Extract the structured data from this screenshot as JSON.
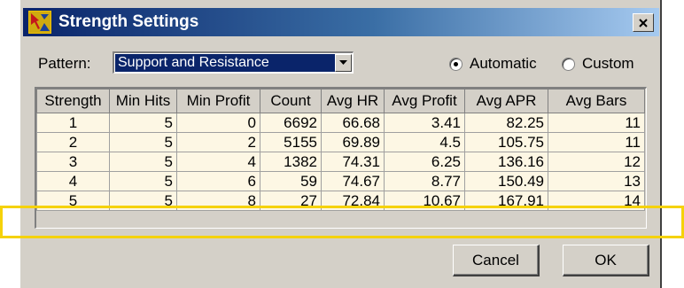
{
  "window": {
    "title": "Strength Settings",
    "close_label": "×",
    "accent_color": "#0a246a",
    "highlight_color": "#f5d20a"
  },
  "pattern": {
    "label": "Pattern:",
    "selected": "Support and Resistance"
  },
  "mode": {
    "automatic_label": "Automatic",
    "custom_label": "Custom",
    "selected": "Automatic"
  },
  "table": {
    "columns": [
      "Strength",
      "Min Hits",
      "Min Profit",
      "Count",
      "Avg HR",
      "Avg Profit",
      "Avg APR",
      "Avg Bars"
    ],
    "rows": [
      [
        "1",
        "5",
        "0",
        "6692",
        "66.68",
        "3.41",
        "82.25",
        "11"
      ],
      [
        "2",
        "5",
        "2",
        "5155",
        "69.89",
        "4.5",
        "105.75",
        "11"
      ],
      [
        "3",
        "5",
        "4",
        "1382",
        "74.31",
        "6.25",
        "136.16",
        "12"
      ],
      [
        "4",
        "5",
        "6",
        "59",
        "74.67",
        "8.77",
        "150.49",
        "13"
      ],
      [
        "5",
        "5",
        "8",
        "27",
        "72.84",
        "10.67",
        "167.91",
        "14"
      ]
    ],
    "highlighted_row": 5
  },
  "buttons": {
    "cancel": "Cancel",
    "ok": "OK"
  },
  "icons": {
    "app": "strength-app-icon",
    "close": "close-icon",
    "dropdown": "chevron-down-icon",
    "annotation": "pointer-arrow-icon"
  }
}
